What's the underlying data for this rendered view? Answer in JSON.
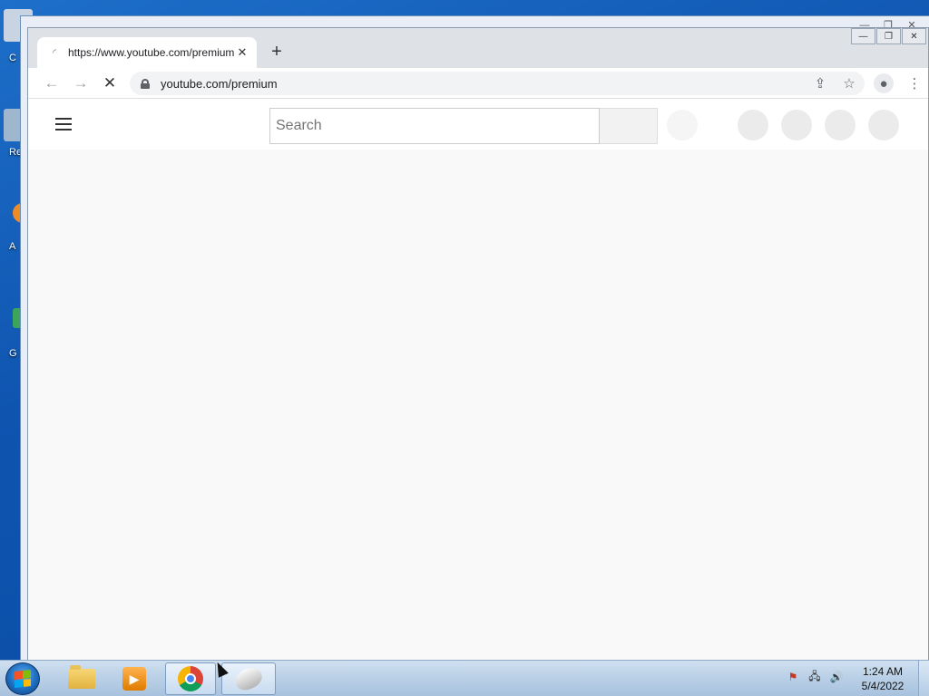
{
  "desktop": {
    "icons": [
      {
        "label": "C",
        "icon": "computer-icon",
        "color": "#c8d4e2"
      },
      {
        "label": "Re",
        "icon": "recycle-bin-icon",
        "color": "#9fb6cf"
      },
      {
        "label": "A",
        "icon": "app-icon",
        "color": "#f08a24"
      },
      {
        "label": "G",
        "icon": "app-icon-2",
        "color": "#3aa55b"
      }
    ]
  },
  "browser": {
    "tab": {
      "title": "https://www.youtube.com/premium",
      "close_label": "✕"
    },
    "new_tab_label": "+",
    "url": "youtube.com/premium",
    "window_controls": {
      "minimize": "—",
      "maximize": "❐",
      "close": "✕"
    }
  },
  "page": {
    "search_placeholder": "Search"
  },
  "taskbar": {
    "apps": [
      {
        "name": "windows-explorer",
        "icon": "folder-icon"
      },
      {
        "name": "media-player",
        "icon": "media-player-icon"
      },
      {
        "name": "google-chrome",
        "icon": "chrome-icon",
        "active": true
      },
      {
        "name": "mouse-app",
        "icon": "mouse-icon"
      }
    ],
    "tray": {
      "flag": "⚑",
      "network": "🖧",
      "volume": "🔊"
    },
    "clock": {
      "time": "1:24 AM",
      "date": "5/4/2022"
    }
  }
}
